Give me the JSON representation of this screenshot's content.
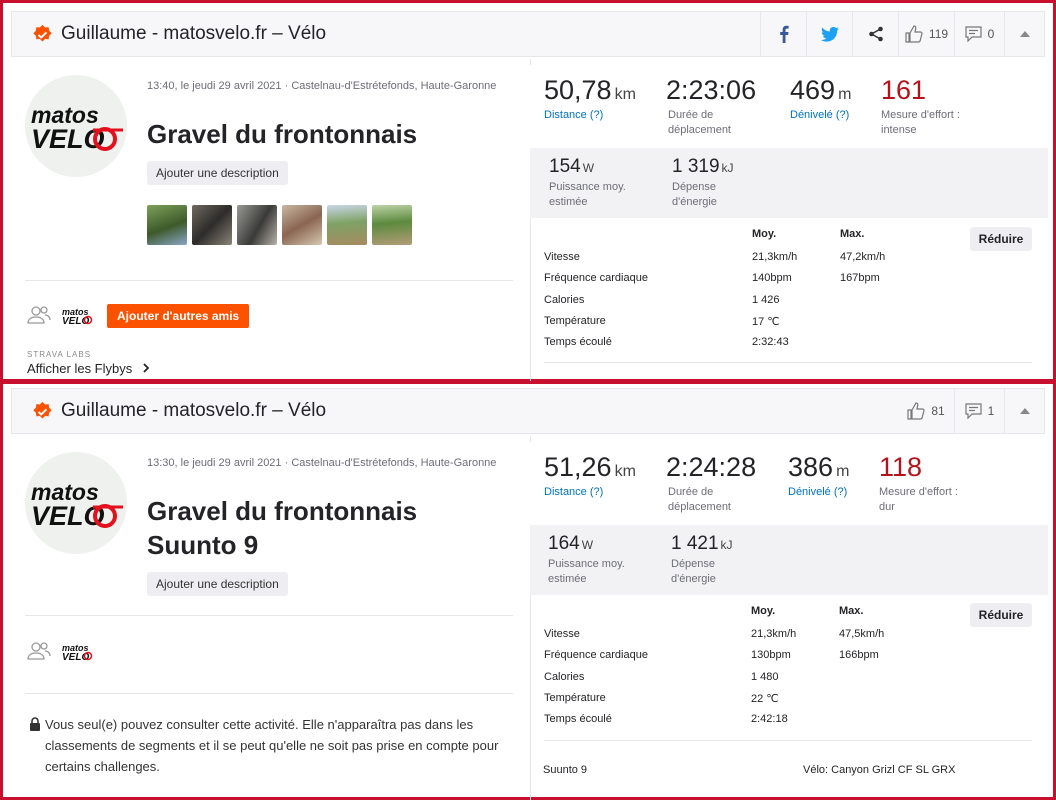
{
  "activities": [
    {
      "header": {
        "title": "Guillaume - matosvelo.fr – Vélo",
        "kudos": "119",
        "comments": "0"
      },
      "meta": "13:40, le jeudi 29 avril 2021 · Castelnau-d'Estrétefonds, Haute-Garonne",
      "title_line1": "Gravel du frontonnais",
      "add_description": "Ajouter une description",
      "add_friends": "Ajouter d'autres amis",
      "labs_label": "STRAVA LABS",
      "flyby_link": "Afficher les Flybys",
      "stats": {
        "distance": {
          "value": "50,78",
          "unit": "km",
          "label": "Distance (?)"
        },
        "moving_time": {
          "value": "2:23:06",
          "label1": "Durée de",
          "label2": "déplacement"
        },
        "elevation": {
          "value": "469",
          "unit": "m",
          "label": "Dénivelé (?)"
        },
        "effort": {
          "value": "161",
          "label1": "Mesure d'effort :",
          "label2": "intense"
        },
        "power": {
          "value": "154",
          "unit": "W",
          "label1": "Puissance moy.",
          "label2": "estimée"
        },
        "energy": {
          "value": "1 319",
          "unit": "kJ",
          "label1": "Dépense",
          "label2": "d'énergie"
        }
      },
      "details": {
        "col_avg": "Moy.",
        "col_max": "Max.",
        "reduce": "Réduire",
        "rows": [
          {
            "label": "Vitesse",
            "avg": "21,3km/h",
            "max": "47,2km/h"
          },
          {
            "label": "Fréquence cardiaque",
            "avg": "140bpm",
            "max": "167bpm"
          },
          {
            "label": "Calories",
            "avg": "1 426",
            "max": ""
          },
          {
            "label": "Température",
            "avg": "17 ℃",
            "max": ""
          },
          {
            "label": "Temps écoulé",
            "avg": "2:32:43",
            "max": ""
          }
        ]
      }
    },
    {
      "header": {
        "title": "Guillaume - matosvelo.fr – Vélo",
        "kudos": "81",
        "comments": "1"
      },
      "meta": "13:30, le jeudi 29 avril 2021 · Castelnau-d'Estrétefonds, Haute-Garonne",
      "title_line1": "Gravel du frontonnais",
      "title_line2": "Suunto 9",
      "add_description": "Ajouter une description",
      "privacy": "Vous seul(e) pouvez consulter cette activité. Elle n'apparaîtra pas dans les classements de segments et il se peut qu'elle ne soit pas prise en compte pour certains challenges.",
      "stats": {
        "distance": {
          "value": "51,26",
          "unit": "km",
          "label": "Distance (?)"
        },
        "moving_time": {
          "value": "2:24:28",
          "label1": "Durée de",
          "label2": "déplacement"
        },
        "elevation": {
          "value": "386",
          "unit": "m",
          "label": "Dénivelé (?)"
        },
        "effort": {
          "value": "118",
          "label1": "Mesure d'effort :",
          "label2": "dur"
        },
        "power": {
          "value": "164",
          "unit": "W",
          "label1": "Puissance moy.",
          "label2": "estimée"
        },
        "energy": {
          "value": "1 421",
          "unit": "kJ",
          "label1": "Dépense",
          "label2": "d'énergie"
        }
      },
      "details": {
        "col_avg": "Moy.",
        "col_max": "Max.",
        "reduce": "Réduire",
        "rows": [
          {
            "label": "Vitesse",
            "avg": "21,3km/h",
            "max": "47,5km/h"
          },
          {
            "label": "Fréquence cardiaque",
            "avg": "130bpm",
            "max": "166bpm"
          },
          {
            "label": "Calories",
            "avg": "1 480",
            "max": ""
          },
          {
            "label": "Température",
            "avg": "22 ℃",
            "max": ""
          },
          {
            "label": "Temps écoulé",
            "avg": "2:42:18",
            "max": ""
          }
        ]
      },
      "device": "Suunto 9",
      "bike": "Vélo: Canyon Grizl CF SL GRX"
    }
  ],
  "logo_text": {
    "line1": "matos",
    "line2": "VELO"
  },
  "colors": {
    "accent_orange": "#fc5200",
    "effort_red": "#b5121b",
    "link_blue": "#0072bc",
    "frame_red": "#c8102e"
  },
  "icons": [
    "verified-badge-icon",
    "facebook-icon",
    "twitter-icon",
    "share-icon",
    "kudos-thumb-icon",
    "comment-icon",
    "collapse-chevron-icon",
    "friends-icon",
    "lock-icon",
    "chevron-right-icon"
  ]
}
